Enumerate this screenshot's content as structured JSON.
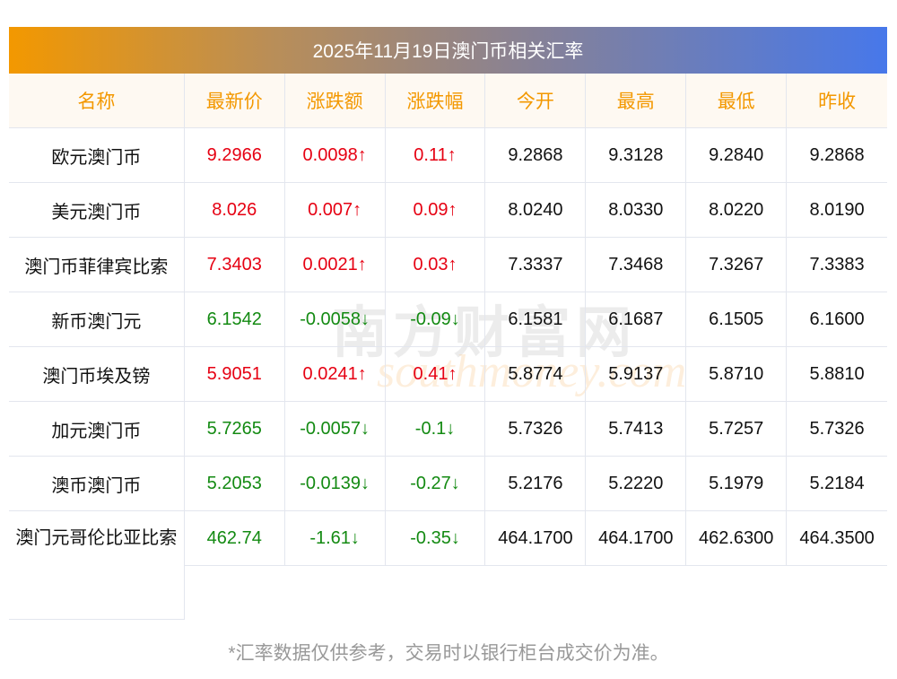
{
  "title": "2025年11月19日澳门币相关汇率",
  "watermark": {
    "cn": "南方财富网",
    "en": "southmoney.com"
  },
  "headers": [
    "名称",
    "最新价",
    "涨跌额",
    "涨跌幅",
    "今开",
    "最高",
    "最低",
    "昨收"
  ],
  "rows": [
    {
      "name": "欧元澳门币",
      "latest": "9.2966",
      "change": "0.0098↑",
      "pct": "0.11↑",
      "open": "9.2868",
      "high": "9.3128",
      "low": "9.2840",
      "prev": "9.2868",
      "dir": "up"
    },
    {
      "name": "美元澳门币",
      "latest": "8.026",
      "change": "0.007↑",
      "pct": "0.09↑",
      "open": "8.0240",
      "high": "8.0330",
      "low": "8.0220",
      "prev": "8.0190",
      "dir": "up"
    },
    {
      "name": "澳门币菲律宾比索",
      "latest": "7.3403",
      "change": "0.0021↑",
      "pct": "0.03↑",
      "open": "7.3337",
      "high": "7.3468",
      "low": "7.3267",
      "prev": "7.3383",
      "dir": "up"
    },
    {
      "name": "新币澳门元",
      "latest": "6.1542",
      "change": "-0.0058↓",
      "pct": "-0.09↓",
      "open": "6.1581",
      "high": "6.1687",
      "low": "6.1505",
      "prev": "6.1600",
      "dir": "down"
    },
    {
      "name": "澳门币埃及镑",
      "latest": "5.9051",
      "change": "0.0241↑",
      "pct": "0.41↑",
      "open": "5.8774",
      "high": "5.9137",
      "low": "5.8710",
      "prev": "5.8810",
      "dir": "up"
    },
    {
      "name": "加元澳门币",
      "latest": "5.7265",
      "change": "-0.0057↓",
      "pct": "-0.1↓",
      "open": "5.7326",
      "high": "5.7413",
      "low": "5.7257",
      "prev": "5.7326",
      "dir": "down"
    },
    {
      "name": "澳币澳门币",
      "latest": "5.2053",
      "change": "-0.0139↓",
      "pct": "-0.27↓",
      "open": "5.2176",
      "high": "5.2220",
      "low": "5.1979",
      "prev": "5.2184",
      "dir": "down"
    },
    {
      "name": "澳门元哥伦比亚比索",
      "latest": "462.74",
      "change": "-1.61↓",
      "pct": "-0.35↓",
      "open": "464.1700",
      "high": "464.1700",
      "low": "462.6300",
      "prev": "464.3500",
      "dir": "down"
    }
  ],
  "colors": {
    "up": "#e60012",
    "down": "#138a12",
    "header": "#f39800"
  },
  "note": "*汇率数据仅供参考，交易时以银行柜台成交价为准。"
}
